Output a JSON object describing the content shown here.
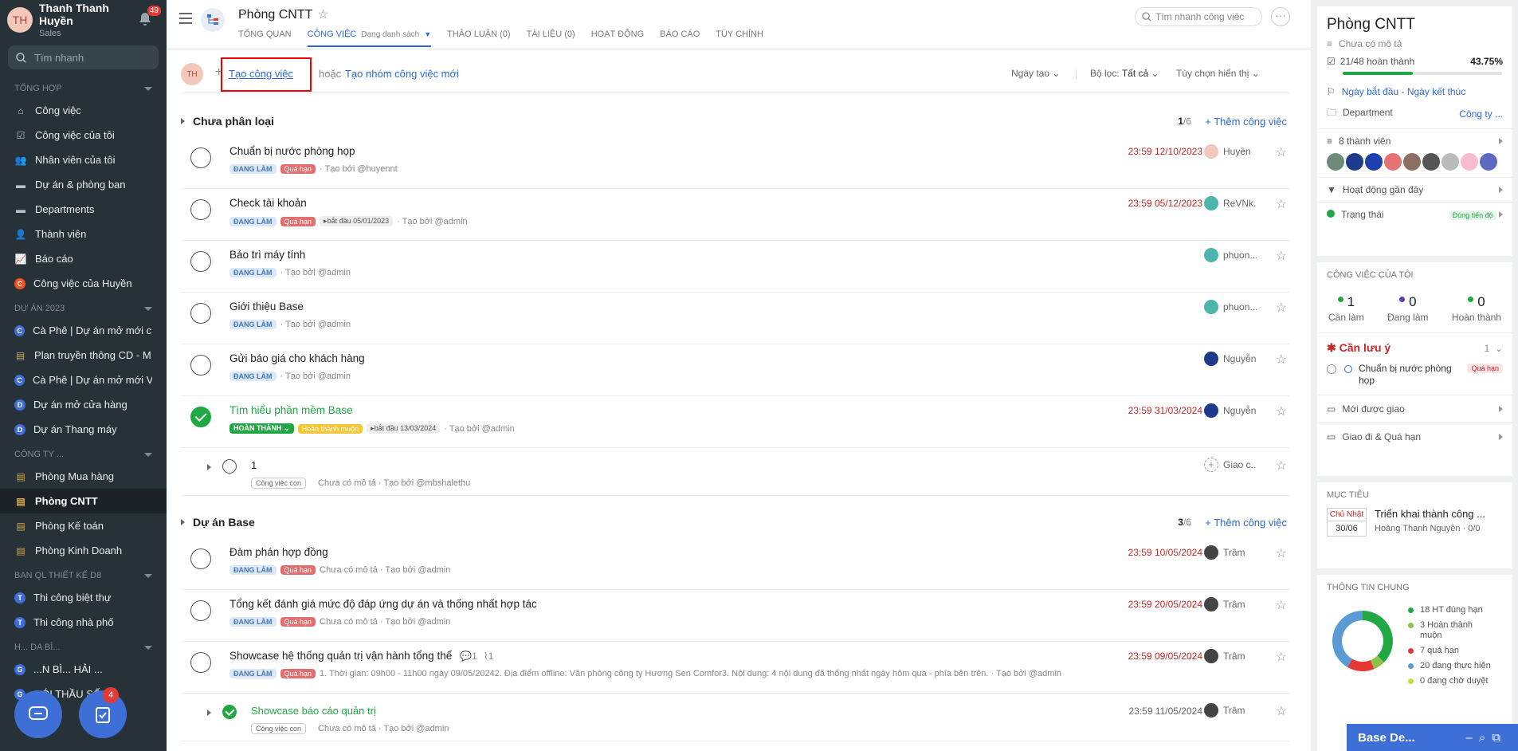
{
  "user": {
    "name": "Thanh Thanh Huyền",
    "role": "Sales",
    "initials": "TH",
    "notif_count": "49"
  },
  "search": {
    "placeholder": "Tìm nhanh"
  },
  "sections": [
    {
      "title": "Tổng hợp",
      "items": [
        {
          "label": "Công việc",
          "icon": "home-icon"
        },
        {
          "label": "Công việc của tôi",
          "icon": "check-square-icon"
        },
        {
          "label": "Nhân viên của tôi",
          "icon": "users-icon"
        },
        {
          "label": "Dự án & phòng ban",
          "icon": "folder-icon"
        },
        {
          "label": "Departments",
          "icon": "folder-icon"
        },
        {
          "label": "Thành viên",
          "icon": "user-plus-icon"
        },
        {
          "label": "Báo cáo",
          "icon": "chart-icon"
        },
        {
          "label": "Công việc của Huyền",
          "icon": "letter-c-icon"
        }
      ]
    },
    {
      "title": "Dự án 2023",
      "items": [
        {
          "label": "Cà Phê | Dự án mở mới c...",
          "letter": "C",
          "color": "#3f6dd8"
        },
        {
          "label": "Plan truyền thông CD - M...",
          "letter": "",
          "color": "#3e8e41"
        },
        {
          "label": "Cà Phê | Dự án mở mới V...",
          "letter": "C",
          "color": "#3f6dd8"
        },
        {
          "label": "Dự án mở cửa hàng",
          "letter": "D",
          "color": "#3f6dd8"
        },
        {
          "label": "Dự án Thang máy",
          "letter": "D",
          "color": "#3f6dd8"
        }
      ]
    },
    {
      "title": "Công ty ...",
      "items": [
        {
          "label": "Phòng Mua hàng"
        },
        {
          "label": "Phòng CNTT"
        },
        {
          "label": "Phòng Kế toán"
        },
        {
          "label": "Phòng Kinh Doanh"
        }
      ]
    },
    {
      "title": "Ban QL thiết kế D8",
      "items": [
        {
          "label": "Thi công biệt thự",
          "letter": "T"
        },
        {
          "label": "Thi công nhà phố",
          "letter": "T"
        }
      ]
    },
    {
      "title": "H... DA BÌ...",
      "items": [
        {
          "label": "...N BÌ... HẢI ...",
          "letter": "G"
        },
        {
          "label": "GÓI THẦU SỐ 28",
          "letter": "G"
        }
      ]
    }
  ],
  "fab_badge": "4",
  "page": {
    "title": "Phòng CNTT",
    "tabs": [
      "Tổng quan",
      "Công việc",
      "Thảo luận (0)",
      "Tài liệu (0)",
      "Hoạt động",
      "Báo cáo",
      "Tùy chỉnh"
    ],
    "view_mode": "Dạng danh sách",
    "quick_search": "Tìm nhanh công việc"
  },
  "toolbar": {
    "create_task": "Tạo công việc",
    "or": "hoặc",
    "create_group": "Tạo nhóm công việc mới",
    "sort": "Ngày tạo",
    "filter_label": "Bộ lọc:",
    "filter_value": "Tất cả",
    "display": "Tùy chọn hiển thị"
  },
  "groups": [
    {
      "name": "Chưa phân loại",
      "done": "1",
      "total": "/6",
      "add": "Thêm công việc"
    },
    {
      "name": "Dự án Base",
      "done": "3",
      "total": "/6",
      "add": "Thêm công việc"
    }
  ],
  "tasks": [
    {
      "title": "Chuẩn bị nước phòng họp",
      "status": "ĐANG LÀM",
      "overdue": "Quá hạn",
      "start": "",
      "note": "· Tạo bởi @huyennt",
      "due": "23:59 12/10/2023",
      "assignee": "Huyền",
      "avc": "#f3c7b9"
    },
    {
      "title": "Check tài khoản",
      "status": "ĐANG LÀM",
      "overdue": "Quá hạn",
      "start": "bắt đầu 05/01/2023",
      "note": "· Tạo bởi @admin",
      "due": "23:59 05/12/2023",
      "assignee": "ReVNk...",
      "avc": "#4db6ac"
    },
    {
      "title": "Bảo trì máy tính",
      "status": "ĐANG LÀM",
      "overdue": "",
      "start": "",
      "note": "· Tạo bởi @admin",
      "due": "",
      "assignee": "phuon...",
      "avc": "#4db6ac"
    },
    {
      "title": "Giới thiệu Base",
      "status": "ĐANG LÀM",
      "overdue": "",
      "start": "",
      "note": "· Tạo bởi @admin",
      "due": "",
      "assignee": "phuon...",
      "avc": "#4db6ac"
    },
    {
      "title": "Gửi báo giá cho khách hàng",
      "status": "ĐANG LÀM",
      "overdue": "",
      "start": "",
      "note": "· Tạo bởi @admin",
      "due": "",
      "assignee": "Nguyễn",
      "avc": "#1e3a8a"
    },
    {
      "title": "Tìm hiểu phần mềm Base",
      "status": "HOÀN THÀNH",
      "overdue": "Hoàn thành muộn",
      "start": "bắt đầu 13/03/2024",
      "note": "· Tạo bởi @admin",
      "due": "23:59 31/03/2024",
      "assignee": "Nguyễn",
      "avc": "#1e3a8a"
    },
    {
      "title": "Đàm phán hợp đồng",
      "status": "ĐANG LÀM",
      "overdue": "Quá hạn",
      "start": "",
      "note": "Chưa có mô tả · Tạo bởi @admin",
      "due": "23:59 10/05/2024",
      "assignee": "Trâm",
      "avc": "#444"
    },
    {
      "title": "Tổng kết đánh giá mức độ đáp ứng dự án và thống nhất hợp tác",
      "status": "ĐANG LÀM",
      "overdue": "Quá hạn",
      "start": "",
      "note": "Chưa có mô tả · Tạo bởi @admin",
      "due": "23:59 20/05/2024",
      "assignee": "Trâm",
      "avc": "#444"
    },
    {
      "title": "Showcase hệ thống quản trị vận hành tổng thể",
      "status": "ĐANG LÀM",
      "overdue": "Quá hạn",
      "start": "",
      "note": "1. Thời gian: 09h00 - 11h00 ngày 09/05/20242. Địa điểm offline: Văn phòng công ty Hương Sen Comfor3. Nội dung: 4 nội dung đã thống nhất ngày hôm qua - phía bên trên. · Tạo bởi @admin",
      "due": "23:59 09/05/2024",
      "assignee": "Trâm",
      "avc": "#444",
      "comments": "1",
      "attach": "1"
    }
  ],
  "subtasks": [
    {
      "title": "1",
      "tag": "Công việc con",
      "note": "Chưa có mô tả · Tạo bởi @mbshalethu",
      "due": "",
      "assignee": "Giao c..."
    },
    {
      "title": "Showcase báo cáo quản trị",
      "tag": "Công việc con",
      "note": "Chưa có mô tả · Tạo bởi @admin",
      "due": "23:59 11/05/2024",
      "assignee": "Trâm"
    }
  ],
  "right": {
    "title": "Phòng CNTT",
    "desc": "Chưa có mô tả",
    "progress_text": "21/48 hoàn thành",
    "progress_pct": "43.75%",
    "progress": 0.4375,
    "dates": "Ngày bắt đầu",
    "dates_sep": "-",
    "dates_end": "Ngày kết thúc",
    "dept_label": "Department",
    "dept_value": "Công ty ...",
    "members": "8 thành viên",
    "activity": "Hoạt động gần đây",
    "status_label": "Trạng thái",
    "status_value": "Đúng tiến độ",
    "my_tasks_title": "Công việc của tôi",
    "my_tasks": [
      {
        "n": "1",
        "l": "Cần làm",
        "c": "#1fa843"
      },
      {
        "n": "0",
        "l": "Đang làm",
        "c": "#5c3cbb"
      },
      {
        "n": "0",
        "l": "Hoàn thành",
        "c": "#1fa843"
      }
    ],
    "attention": "Cần lưu ý",
    "attention_count": "1",
    "att_task": "Chuẩn bị nước phòng họp",
    "att_tag": "Quá hạn",
    "assigned": "Mới được giao",
    "overdue": "Giao đi & Quá hạn",
    "goal_title": "Mục tiêu",
    "goal_day": "Chủ Nhật",
    "goal_date": "30/06",
    "goal_name": "Triển khai thành công ...",
    "goal_owner": "Hoàng Thanh Nguyện",
    "goal_score": "· 0/0",
    "info_title": "Thông tin chung",
    "legend": [
      {
        "t": "18 HT đúng hạn",
        "c": "#1fa843",
        "v": 18
      },
      {
        "t": "3 Hoàn thành muộn",
        "c": "#8bc34a",
        "v": 3
      },
      {
        "t": "7 quá hạn",
        "c": "#e53935",
        "v": 7
      },
      {
        "t": "20 đang thực hiện",
        "c": "#5b9bd5",
        "v": 20
      },
      {
        "t": "0 đang chờ duyệt",
        "c": "#cddc39",
        "v": 0
      }
    ],
    "mini_title": "Base De..."
  }
}
